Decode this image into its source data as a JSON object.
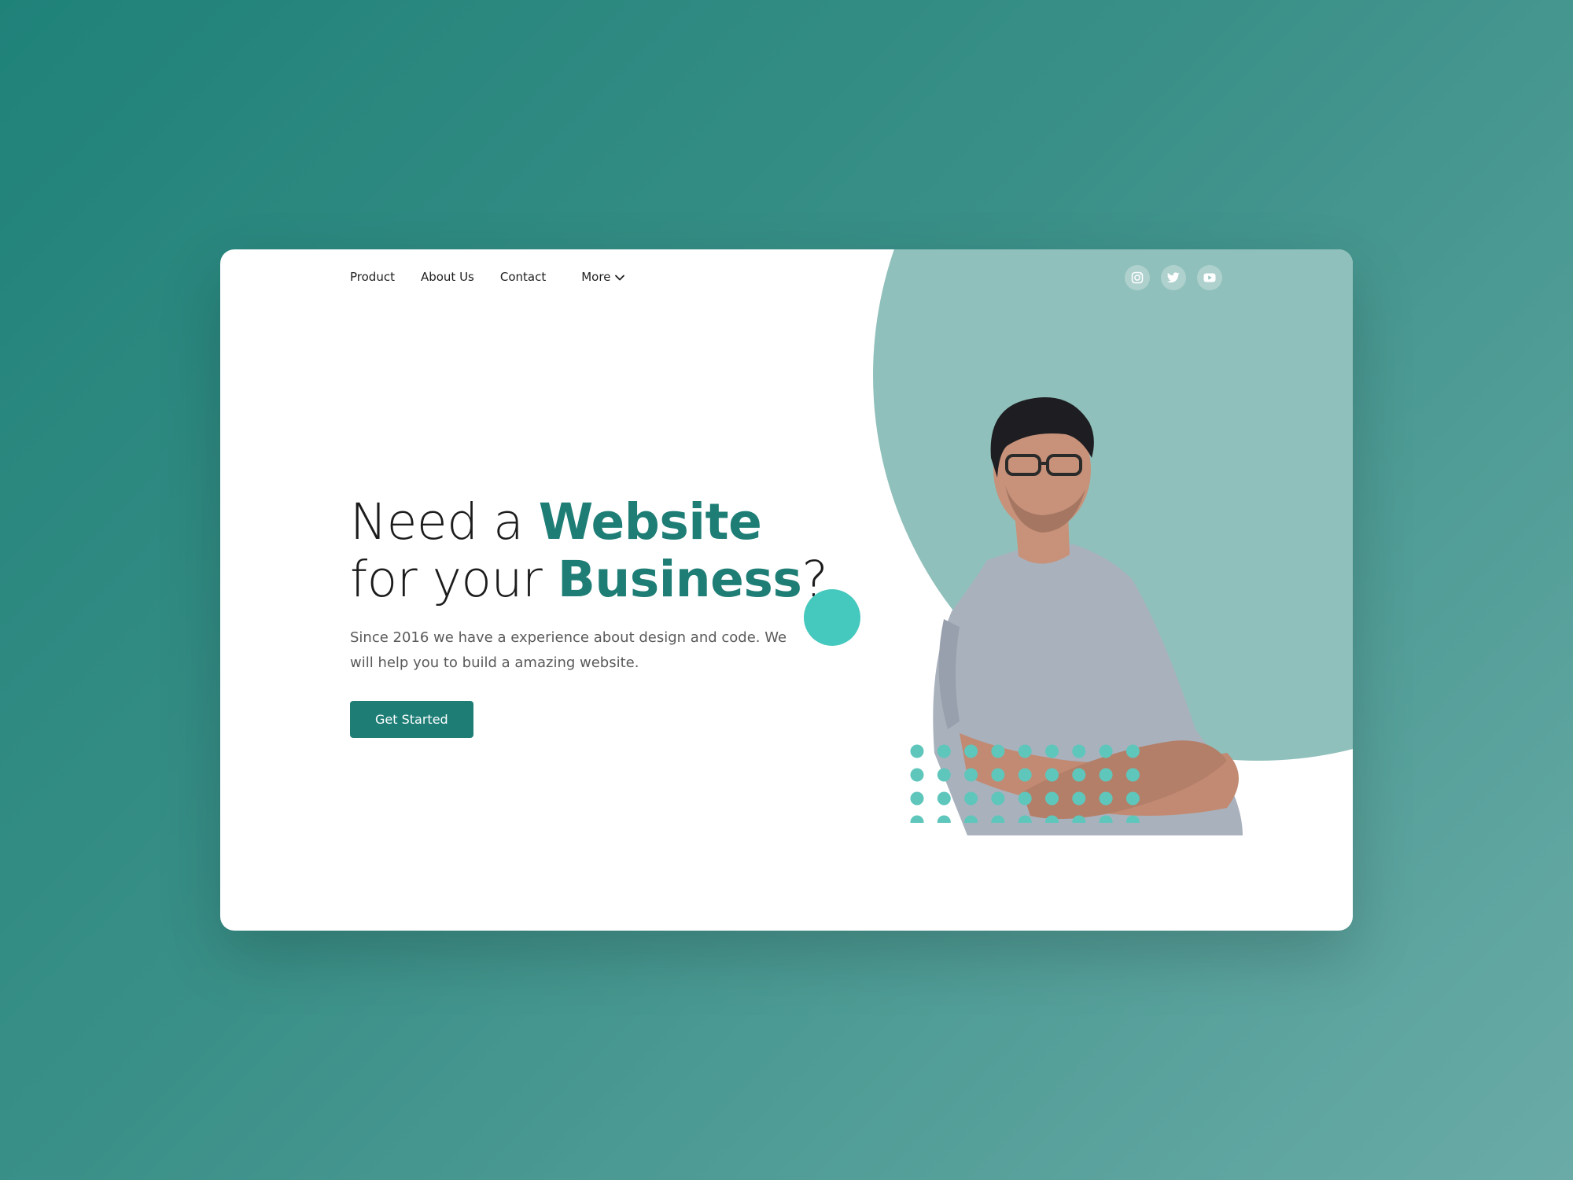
{
  "nav": {
    "items": [
      "Product",
      "About Us",
      "Contact"
    ],
    "more_label": "More"
  },
  "socials": [
    "instagram-icon",
    "twitter-icon",
    "youtube-icon"
  ],
  "hero": {
    "title_part1": "Need a ",
    "title_highlight1": "Website",
    "title_part2": "for your ",
    "title_highlight2": "Business",
    "title_part3": "?",
    "subtitle": "Since 2016 we have a experience about design and code. We will help you to build a amazing website.",
    "cta_label": "Get Started"
  },
  "colors": {
    "accent": "#1e7e76",
    "blob": "#90c0bb",
    "dot": "#45c8bd",
    "pattern_dot": "#5fc6bc"
  }
}
